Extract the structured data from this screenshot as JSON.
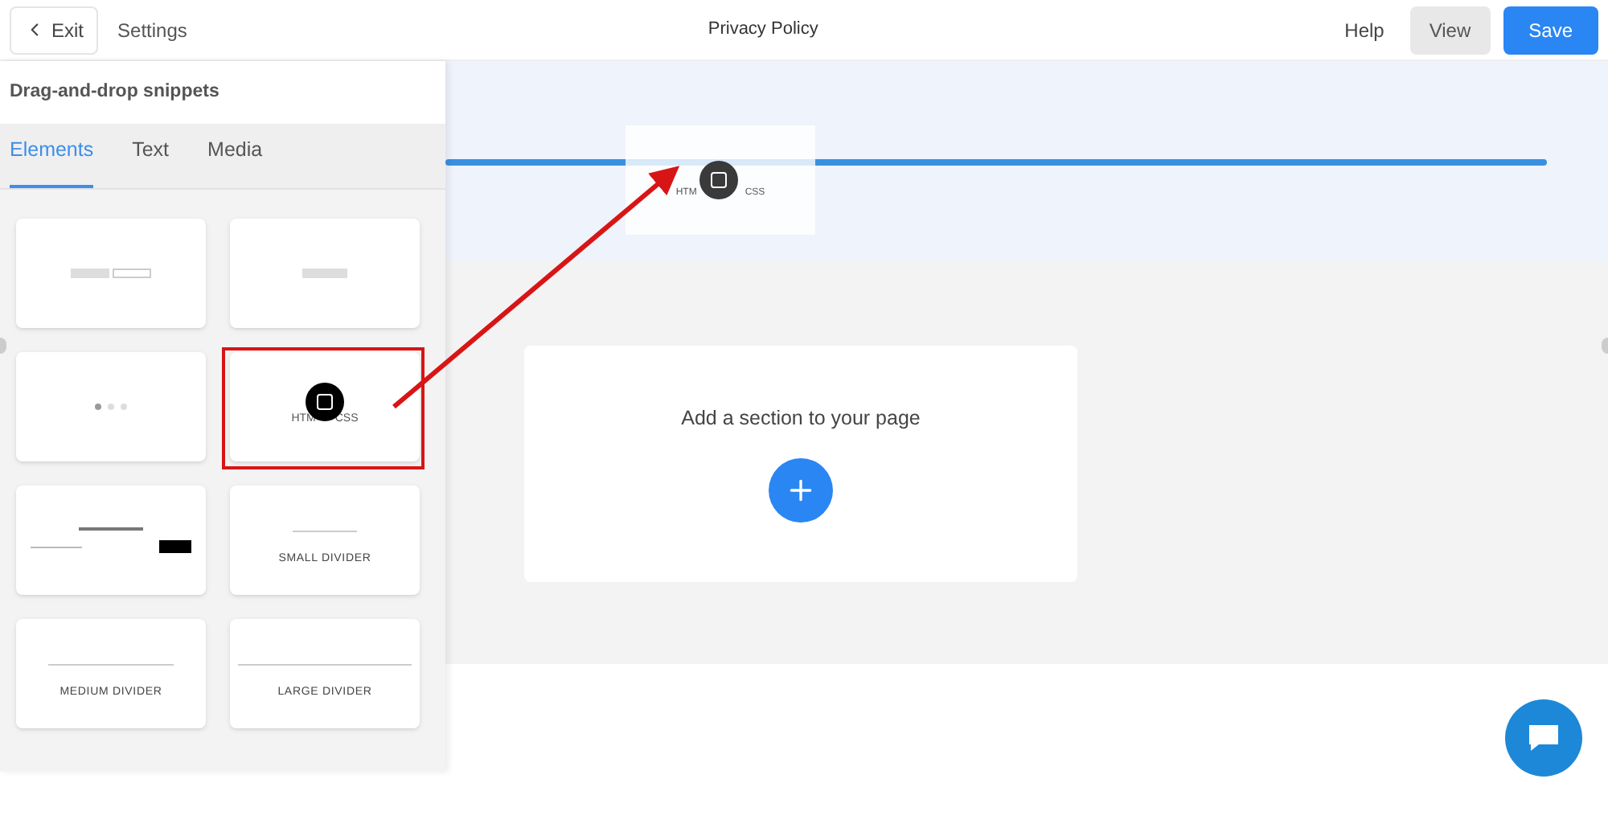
{
  "top_bar": {
    "exit": "Exit",
    "settings": "Settings",
    "title": "Privacy Policy",
    "help": "Help",
    "view": "View",
    "save": "Save"
  },
  "snippets_panel": {
    "title": "Drag-and-drop snippets",
    "tabs": [
      {
        "label": "Elements",
        "selected": true
      },
      {
        "label": "Text",
        "selected": false
      },
      {
        "label": "Media",
        "selected": false
      }
    ],
    "snippets": [
      {
        "kind": "two-buttons"
      },
      {
        "kind": "one-button"
      },
      {
        "kind": "slider-dots"
      },
      {
        "kind": "html",
        "label_parts": [
          "HTM",
          "CSS"
        ],
        "highlighted": true
      },
      {
        "kind": "newsletter"
      },
      {
        "kind": "small-divider",
        "label": "SMALL DIVIDER"
      },
      {
        "kind": "medium-divider",
        "label": "MEDIUM DIVIDER"
      },
      {
        "kind": "large-divider",
        "label": "LARGE DIVIDER"
      }
    ]
  },
  "dragged_snippet": {
    "label_parts": [
      "HTM",
      "CSS"
    ]
  },
  "empty_section": {
    "text": "Add a section to your page"
  }
}
